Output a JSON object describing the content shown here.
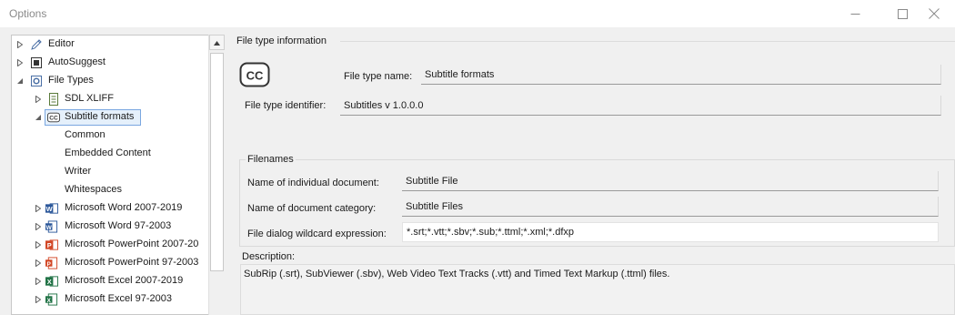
{
  "window": {
    "title": "Options",
    "controls": {
      "minimize": "minimize-icon",
      "maximize": "maximize-icon",
      "close": "close-icon"
    }
  },
  "tree": {
    "items": [
      {
        "label": "Editor",
        "icon": "pencil-icon",
        "expander": "collapsed"
      },
      {
        "label": "AutoSuggest",
        "icon": "autosuggest-icon",
        "expander": "collapsed"
      },
      {
        "label": "File Types",
        "icon": "filetypes-gear-icon",
        "expander": "expanded"
      },
      {
        "label": "SDL XLIFF",
        "icon": "xliff-icon",
        "expander": "collapsed"
      },
      {
        "label": "Subtitle formats",
        "icon": "cc-icon",
        "expander": "expanded",
        "selected": true
      },
      {
        "label": "Common",
        "icon": "",
        "expander": "none"
      },
      {
        "label": "Embedded Content",
        "icon": "",
        "expander": "none"
      },
      {
        "label": "Writer",
        "icon": "",
        "expander": "none"
      },
      {
        "label": "Whitespaces",
        "icon": "",
        "expander": "none"
      },
      {
        "label": "Microsoft Word 2007-2019",
        "icon": "word-icon",
        "expander": "collapsed"
      },
      {
        "label": "Microsoft Word 97-2003",
        "icon": "word-legacy-icon",
        "expander": "collapsed"
      },
      {
        "label": "Microsoft PowerPoint 2007-20",
        "icon": "powerpoint-icon",
        "expander": "collapsed"
      },
      {
        "label": "Microsoft PowerPoint 97-2003",
        "icon": "powerpoint-legacy-icon",
        "expander": "collapsed"
      },
      {
        "label": "Microsoft Excel 2007-2019",
        "icon": "excel-icon",
        "expander": "collapsed"
      },
      {
        "label": "Microsoft Excel 97-2003",
        "icon": "excel-legacy-icon",
        "expander": "collapsed"
      }
    ]
  },
  "file_type_info": {
    "section_title": "File type information",
    "name_label": "File type name:",
    "name_value": "Subtitle formats",
    "identifier_label": "File type identifier:",
    "identifier_value": "Subtitles v 1.0.0.0"
  },
  "filenames": {
    "section_title": "Filenames",
    "doc_label": "Name of individual document:",
    "doc_value": "Subtitle File",
    "category_label": "Name of document category:",
    "category_value": "Subtitle Files",
    "wildcard_label": "File dialog wildcard expression:",
    "wildcard_value": "*.srt;*.vtt;*.sbv;*.sub;*.ttml;*.xml;*.dfxp"
  },
  "description": {
    "label": "Description:",
    "text": "SubRip (.srt), SubViewer (.sbv), Web Video Text Tracks (.vtt) and Timed Text Markup (.ttml) files."
  },
  "colors": {
    "selection_border": "#7aa7e0",
    "selection_fill": "#e5f0fb",
    "word_blue": "#2b579a",
    "powerpoint_red": "#d24726",
    "excel_green": "#217346"
  }
}
